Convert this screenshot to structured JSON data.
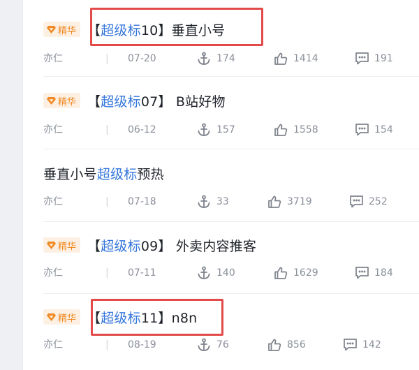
{
  "posts": [
    {
      "featured": true,
      "badge": "精华",
      "title_prefix": "【",
      "title_highlight": "超级标",
      "title_rest": "10】垂直小号",
      "author": "亦仁",
      "date": "07-20",
      "anchors": "174",
      "likes": "1414",
      "comments": "191",
      "boxed": true
    },
    {
      "featured": true,
      "badge": "精华",
      "title_prefix": "【",
      "title_highlight": "超级标",
      "title_rest": "07】 B站好物",
      "author": "亦仁",
      "date": "06-12",
      "anchors": "157",
      "likes": "1558",
      "comments": "154",
      "boxed": false
    },
    {
      "featured": false,
      "badge": "",
      "title_prefix": "垂直小号",
      "title_highlight": "超级标",
      "title_rest": "预热",
      "author": "亦仁",
      "date": "07-18",
      "anchors": "33",
      "likes": "3719",
      "comments": "252",
      "boxed": false
    },
    {
      "featured": true,
      "badge": "精华",
      "title_prefix": "【",
      "title_highlight": "超级标",
      "title_rest": "09】 外卖内容推客",
      "author": "亦仁",
      "date": "07-11",
      "anchors": "140",
      "likes": "1629",
      "comments": "184",
      "boxed": false
    },
    {
      "featured": true,
      "badge": "精华",
      "title_prefix": "【",
      "title_highlight": "超级标",
      "title_rest": "11】n8n",
      "author": "亦仁",
      "date": "08-19",
      "anchors": "76",
      "likes": "856",
      "comments": "142",
      "boxed": true
    }
  ],
  "separator": "|",
  "colors": {
    "badge_bg": "#fdf0e3",
    "badge_text": "#f08a24",
    "highlight": "#3476dc",
    "annotation_box": "#e34a4a"
  },
  "icons": [
    "diamond-icon",
    "anchor-icon",
    "thumbs-up-icon",
    "comment-icon"
  ]
}
